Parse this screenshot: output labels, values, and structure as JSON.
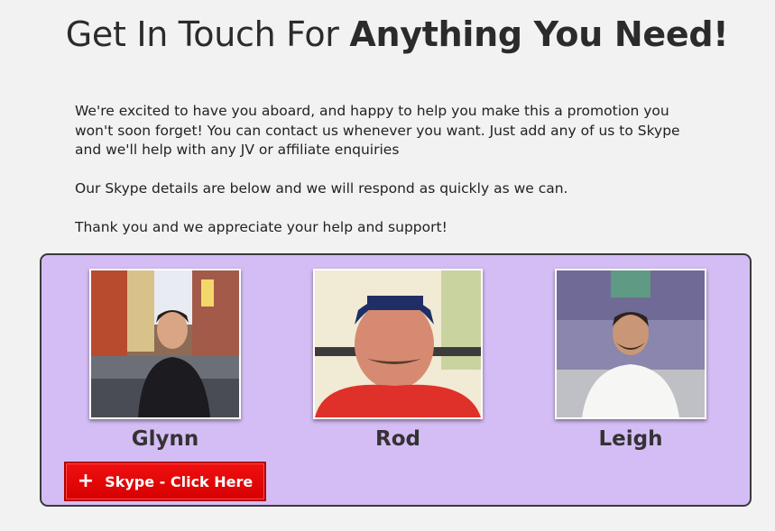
{
  "header": {
    "title_light": "Get In Touch For",
    "title_bold": "Anything You Need!"
  },
  "intro": {
    "paragraph1": "We're excited to have you aboard, and happy to help you make this a promotion you won't soon forget!  You can contact us whenever you want.  Just add any of us to Skype and we'll help with any JV or affiliate enquiries",
    "paragraph2": "Our Skype details are below and we will respond as quickly as we can.",
    "paragraph3": "Thank you and we appreciate your help and support!"
  },
  "team": {
    "background_color": "#d4bdf4",
    "members": [
      {
        "name": "Glynn",
        "icon": "person-photo"
      },
      {
        "name": "Rod",
        "icon": "person-photo"
      },
      {
        "name": "Leigh",
        "icon": "person-photo"
      }
    ],
    "skype_button": {
      "label": "Skype - Click Here",
      "icon": "plus-icon",
      "color": "#e80606"
    }
  }
}
